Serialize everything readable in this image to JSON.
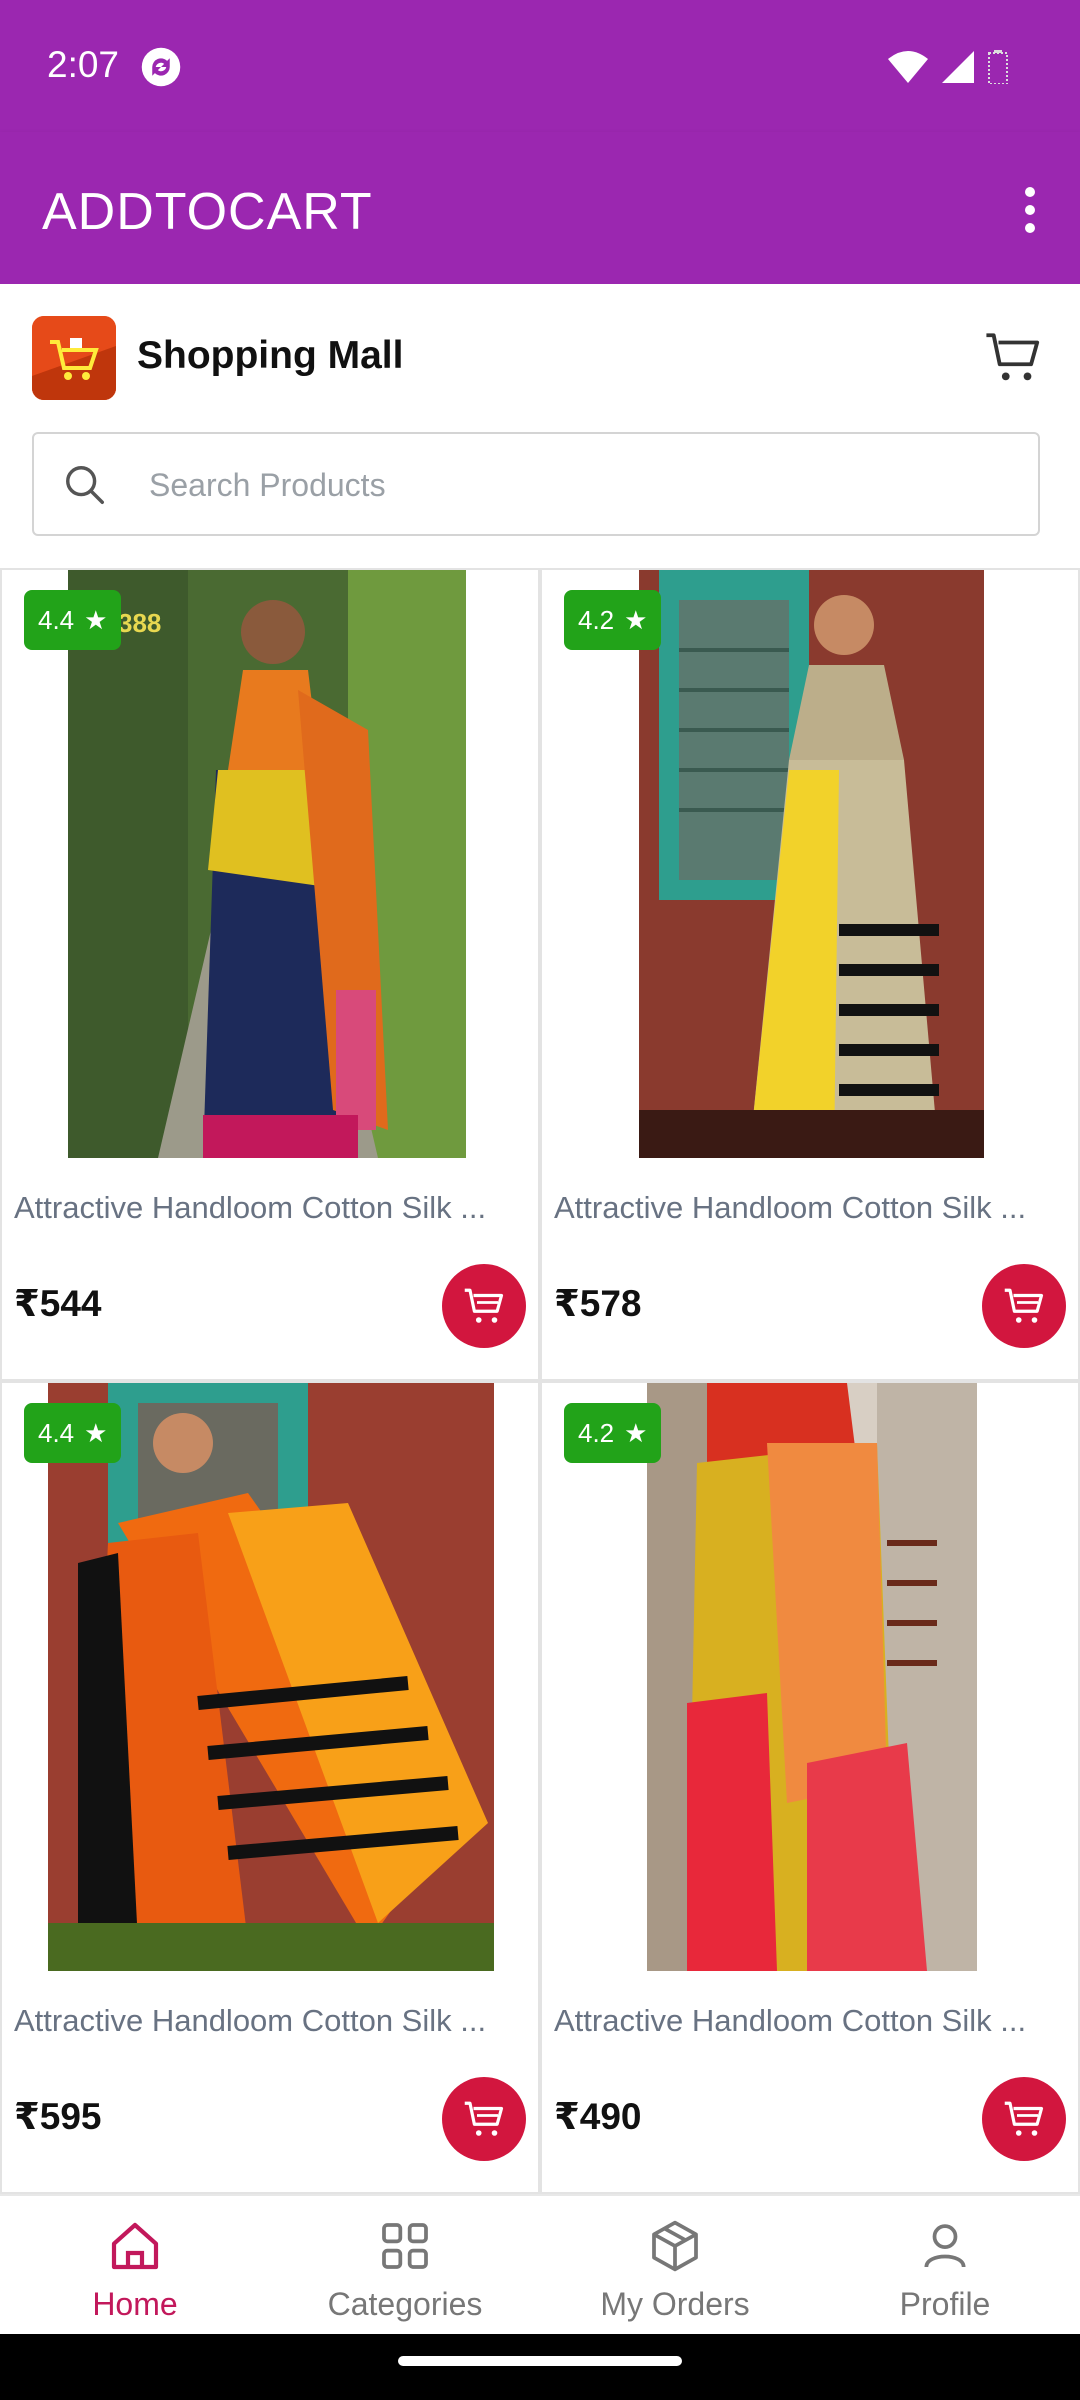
{
  "status_bar": {
    "time": "2:07"
  },
  "app_bar": {
    "title": "ADDTOCART"
  },
  "header": {
    "brand_name": "Shopping Mall"
  },
  "search": {
    "placeholder": "Search Products",
    "value": ""
  },
  "products": [
    {
      "rating": "4.4",
      "name": "Attractive Handloom Cotton Silk ...",
      "price": "₹544",
      "image_watermark": "388"
    },
    {
      "rating": "4.2",
      "name": "Attractive Handloom Cotton Silk ...",
      "price": "₹578"
    },
    {
      "rating": "4.4",
      "name": "Attractive Handloom Cotton Silk ...",
      "price": "₹595"
    },
    {
      "rating": "4.2",
      "name": "Attractive Handloom Cotton Silk ...",
      "price": "₹490"
    }
  ],
  "bottom_nav": [
    {
      "label": "Home",
      "icon": "home-icon",
      "active": true
    },
    {
      "label": "Categories",
      "icon": "grid-icon",
      "active": false
    },
    {
      "label": "My Orders",
      "icon": "box-icon",
      "active": false
    },
    {
      "label": "Profile",
      "icon": "person-icon",
      "active": false
    }
  ],
  "colors": {
    "primary": "#9b27b0",
    "rating_badge": "#22a319",
    "cart_button": "#d2163e",
    "nav_active": "#c2185b",
    "nav_inactive": "#777777"
  }
}
